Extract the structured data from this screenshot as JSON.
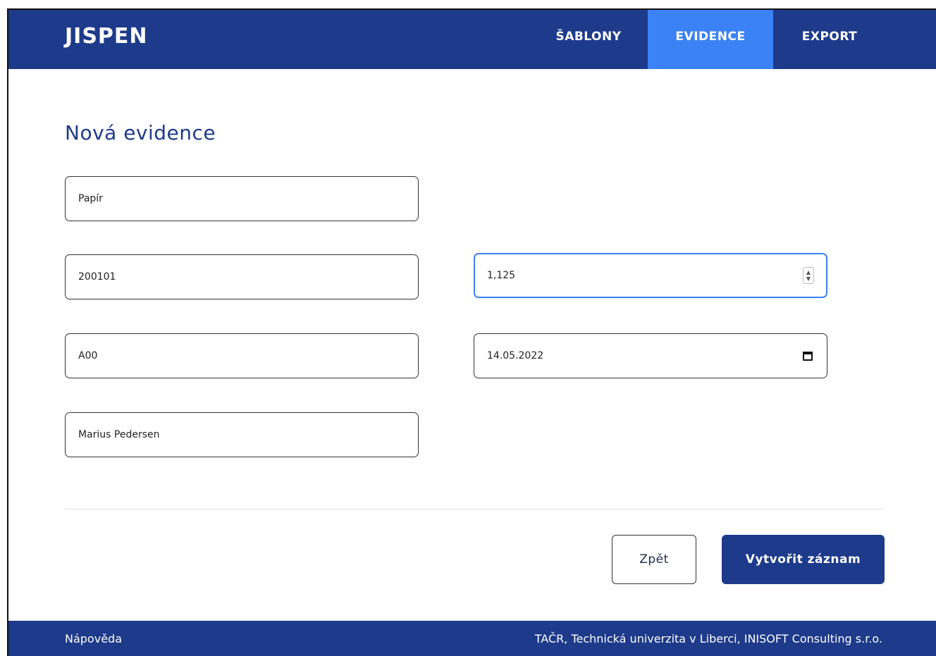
{
  "header": {
    "brand": "JISPEN",
    "nav": [
      {
        "label": "ŠABLONY",
        "active": false
      },
      {
        "label": "EVIDENCE",
        "active": true
      },
      {
        "label": "EXPORT",
        "active": false
      }
    ]
  },
  "main": {
    "title": "Nová evidence",
    "fields": {
      "material": "Papír",
      "code": "200101",
      "quantity": "1,125",
      "category": "A00",
      "date": "14.05.2022",
      "company": "Marius Pedersen"
    },
    "buttons": {
      "back": "Zpět",
      "create": "Vytvořit záznam"
    }
  },
  "footer": {
    "help": "Nápověda",
    "credits": "TAČR, Technická univerzita v Liberci, INISOFT Consulting s.r.o."
  },
  "colors": {
    "primary": "#1e3a8a",
    "accent": "#3b82f6"
  }
}
